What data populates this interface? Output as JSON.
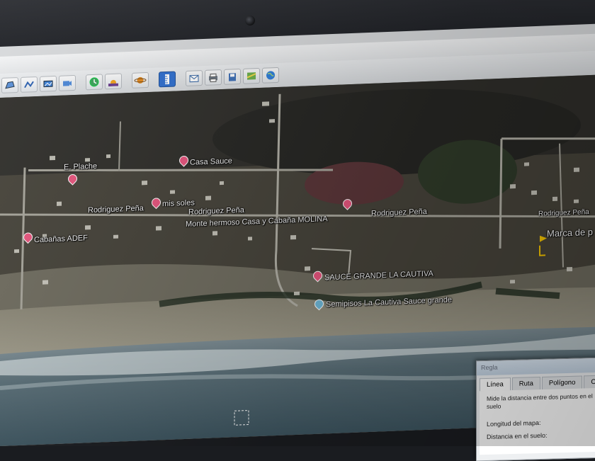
{
  "toolbar": {
    "tools": [
      {
        "icon": "add-polygon-icon"
      },
      {
        "icon": "add-path-icon"
      },
      {
        "icon": "add-overlay-icon"
      },
      {
        "icon": "record-tour-icon"
      },
      {
        "icon": "historical-imagery-icon"
      },
      {
        "icon": "sunlight-icon"
      },
      {
        "icon": "planets-icon"
      },
      {
        "icon": "ruler-icon"
      },
      {
        "icon": "email-icon"
      },
      {
        "icon": "print-icon"
      },
      {
        "icon": "save-image-icon"
      },
      {
        "icon": "view-in-maps-icon"
      },
      {
        "icon": "globe-icon"
      }
    ]
  },
  "map": {
    "labels": {
      "e_plache": "E. Plache",
      "casa_sauce": "Casa Sauce",
      "rodriguez_pena_1": "Rodriguez Peña",
      "mis_soles": "mis soles",
      "rodriguez_pena_2": "Rodriguez Peña",
      "cabanas_adef": "Cabañas ADEF",
      "monte_hermoso": "Monte hermoso Casa y Cabaña MOLINA",
      "rodriguez_pena_3": "Rodriguez Peña",
      "rodriguez_pena_4": "Rodriguez Peña",
      "marca": "Marca de p",
      "sauce_grande": "SAUCE GRANDE LA CAUTIVA",
      "semipisos": "Semipisos La Cautiva Sauce grande"
    }
  },
  "ruler_dialog": {
    "title": "Regla",
    "tabs": [
      "Línea",
      "Ruta",
      "Polígono",
      "Círculo"
    ],
    "active_tab": "Línea",
    "description": "Mide la distancia entre dos puntos en el suelo",
    "map_length_label": "Longitud del mapa:",
    "ground_distance_label": "Distancia en el suelo:"
  }
}
